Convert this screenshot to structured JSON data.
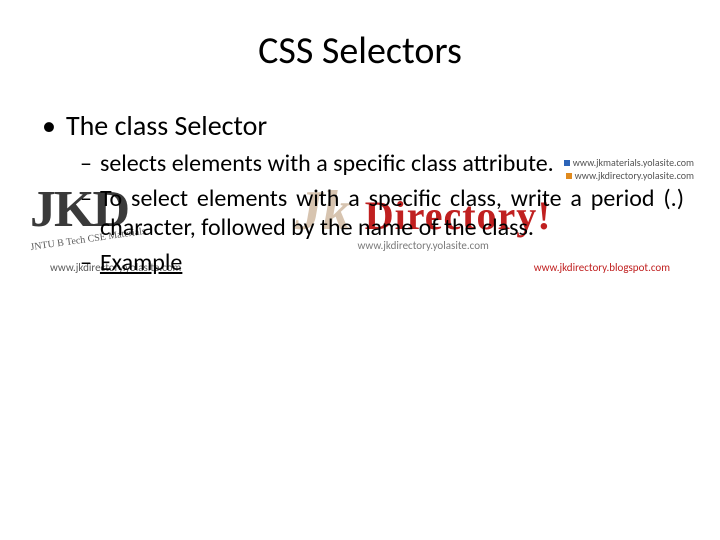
{
  "title": "CSS Selectors",
  "bullet1": {
    "label": "The class Selector"
  },
  "sub": {
    "item1": "selects elements with a specific class attribute.",
    "item2": "To select elements with a specific class, write a period (.) character, followed by the name of the class.",
    "item3": "Example"
  },
  "watermark": {
    "jkd": "JKD",
    "tag": "JNTU B Tech CSE Materials",
    "dir_prefix": "Jk",
    "dir_word": "Directory!",
    "url_mid": "www.jkdirectory.yolasite.com",
    "links": {
      "a": "www.jkmaterials.yolasite.com",
      "b": "www.jkdirectory.yolasite.com"
    },
    "bottom_right": "www.jkdirectory.blogspot.com"
  }
}
